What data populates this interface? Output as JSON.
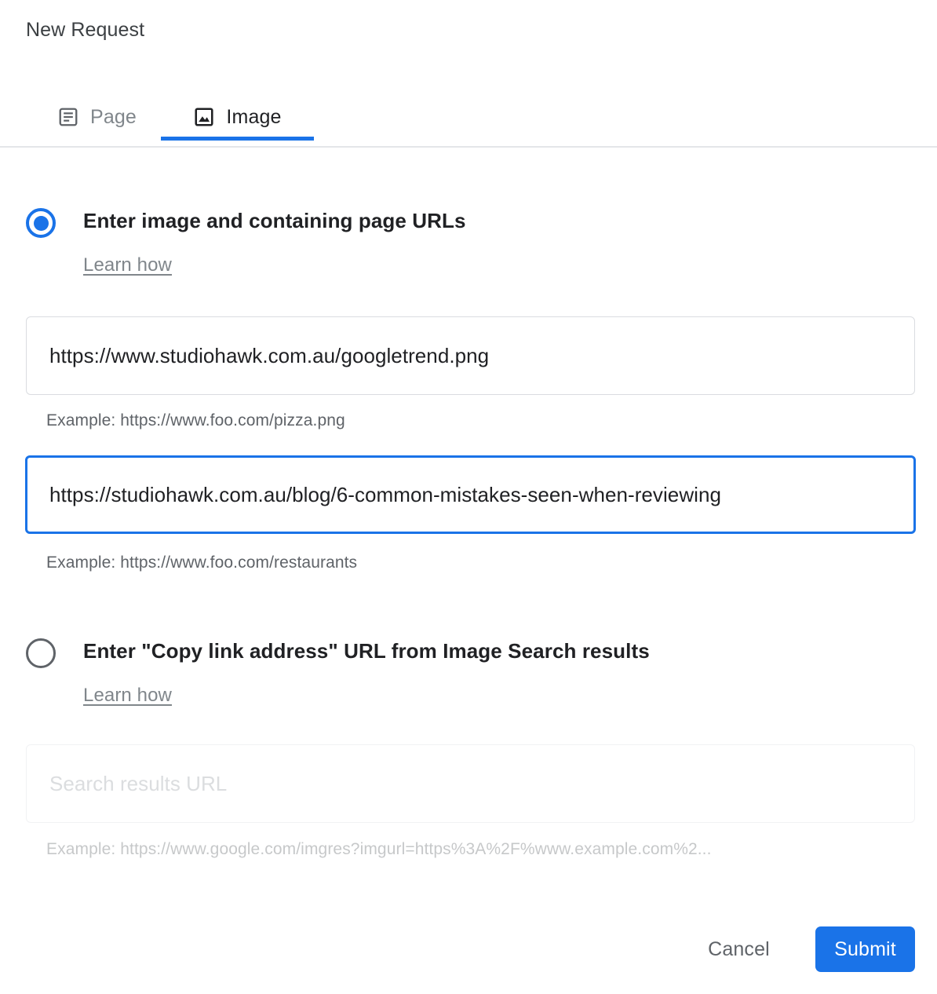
{
  "dialog": {
    "title": "New Request"
  },
  "tabs": [
    {
      "id": "page",
      "label": "Page",
      "icon": "article-icon",
      "active": false
    },
    {
      "id": "image",
      "label": "Image",
      "icon": "image-icon",
      "active": true
    }
  ],
  "options": [
    {
      "id": "image-and-page-urls",
      "label": "Enter image and containing page URLs",
      "selected": true,
      "learn_more": "Learn how",
      "fields": [
        {
          "id": "image-url",
          "value": "https://www.studiohawk.com.au/googletrend.png",
          "placeholder": "",
          "hint": "Example: https://www.foo.com/pizza.png",
          "focused": false
        },
        {
          "id": "page-url",
          "value": "https://studiohawk.com.au/blog/6-common-mistakes-seen-when-reviewing",
          "placeholder": "",
          "hint": "Example: https://www.foo.com/restaurants",
          "focused": true
        }
      ]
    },
    {
      "id": "copy-link-address-url",
      "label": "Enter \"Copy link address\" URL from Image Search results",
      "selected": false,
      "learn_more": "Learn how",
      "fields": [
        {
          "id": "search-results-url",
          "value": "",
          "placeholder": "Search results URL",
          "hint": "Example: https://www.google.com/imgres?imgurl=https%3A%2F%www.example.com%2...",
          "focused": false
        }
      ]
    }
  ],
  "footer": {
    "cancel_label": "Cancel",
    "submit_label": "Submit"
  },
  "colors": {
    "accent": "#1a73e8",
    "text_primary": "#202124",
    "text_secondary": "#5f6368",
    "text_muted": "#80868b",
    "border": "#dadce0"
  }
}
